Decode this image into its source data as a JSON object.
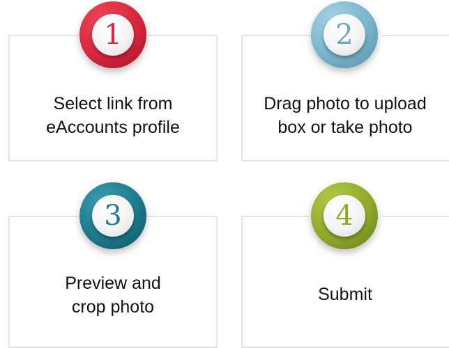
{
  "steps": [
    {
      "number": "1",
      "line1": "Select link from",
      "line2": "eAccounts profile",
      "color": "#d7263d"
    },
    {
      "number": "2",
      "line1": "Drag photo to upload",
      "line2": "box or take photo",
      "color": "#79b4cc"
    },
    {
      "number": "3",
      "line1": "Preview and",
      "line2": "crop photo",
      "color": "#1c7a8c"
    },
    {
      "number": "4",
      "line1": "Submit",
      "line2": "",
      "color": "#8faa2b"
    }
  ]
}
